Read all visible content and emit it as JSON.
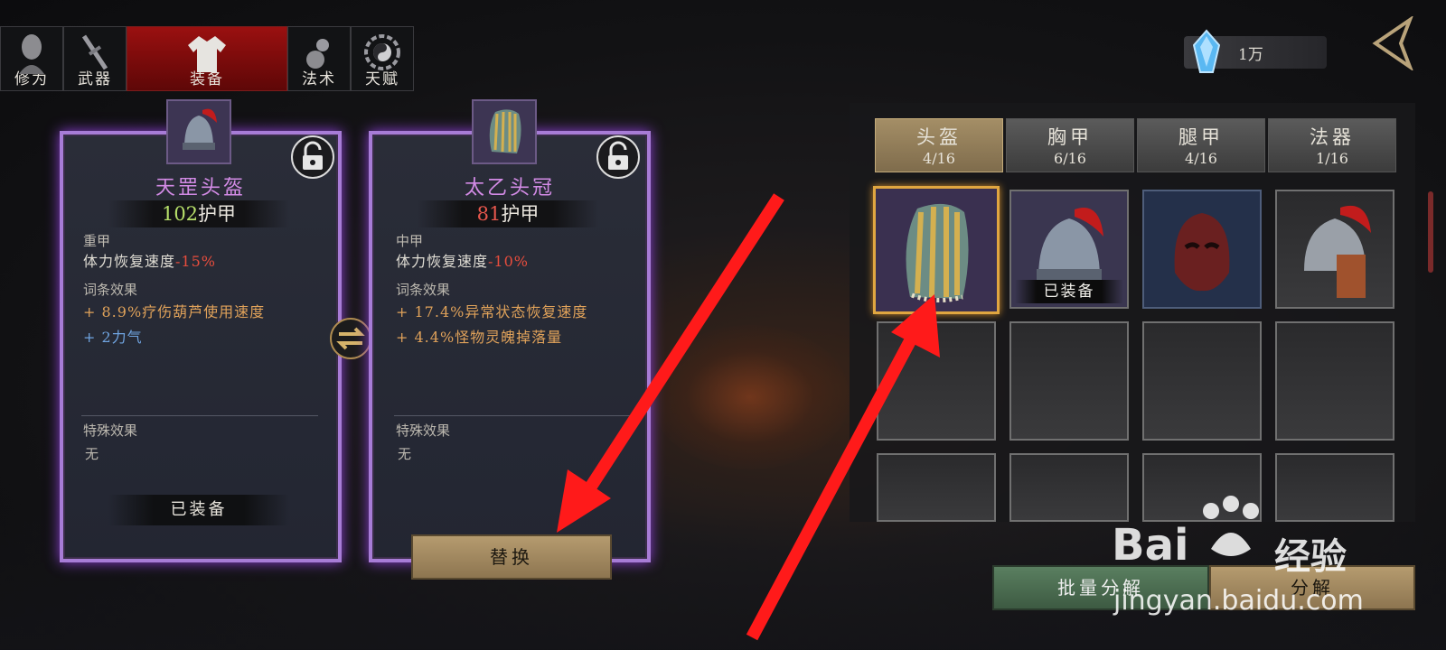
{
  "nav": {
    "tabs": [
      {
        "label": "修为"
      },
      {
        "label": "武器"
      },
      {
        "label": "装备"
      },
      {
        "label": "法术"
      },
      {
        "label": "天赋"
      }
    ],
    "active_index": 2
  },
  "resource": {
    "value": "1万",
    "icon": "crystal-icon"
  },
  "compare": {
    "current": {
      "name": "天罡头盔",
      "armor_value": "102",
      "armor_label": "护甲",
      "type": "重甲",
      "stamina_label": "体力恢复速度",
      "stamina_value": "-15%",
      "affix_title": "词条效果",
      "affixes": [
        {
          "prefix": "+ ",
          "text": "8.9%疗伤葫芦使用速度"
        },
        {
          "prefix": "+ ",
          "text": "2力气"
        }
      ],
      "special_title": "特殊效果",
      "special_value": "无",
      "status": "已装备"
    },
    "candidate": {
      "name": "太乙头冠",
      "armor_value": "81",
      "armor_label": "护甲",
      "type": "中甲",
      "stamina_label": "体力恢复速度",
      "stamina_value": "-10%",
      "affix_title": "词条效果",
      "affixes": [
        {
          "prefix": "+ ",
          "text": "17.4%异常状态恢复速度"
        },
        {
          "prefix": "+ ",
          "text": "4.4%怪物灵魄掉落量"
        }
      ],
      "special_title": "特殊效果",
      "special_value": "无"
    },
    "replace_label": "替换"
  },
  "inventory": {
    "categories": [
      {
        "label": "头盔",
        "count": "4/16"
      },
      {
        "label": "胸甲",
        "count": "6/16"
      },
      {
        "label": "腿甲",
        "count": "4/16"
      },
      {
        "label": "法器",
        "count": "1/16"
      }
    ],
    "equipped_label": "已装备"
  },
  "actions": {
    "batch_label": "批量分解",
    "decompose_label": "分解"
  },
  "watermark": {
    "brand": "Bai",
    "brand2": "经验",
    "url": "jingyan.baidu.com"
  },
  "colors": {
    "active_tab": "#9a1010",
    "card_border": "#a77cd6",
    "rarity_name": "#d38be6",
    "negative": "#e84d3d",
    "affix_gold": "#e0a25a",
    "affix_blue": "#6fa4e0",
    "arrow": "#ff1a1a"
  }
}
